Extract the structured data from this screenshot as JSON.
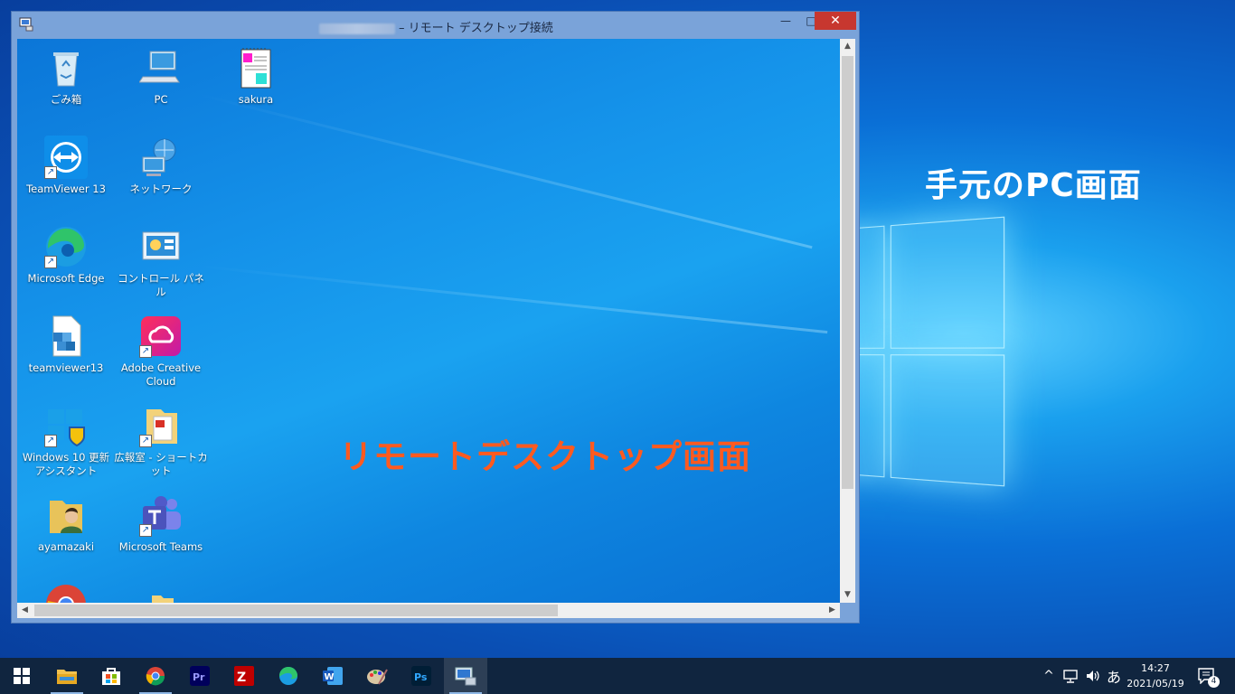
{
  "host": {
    "label": "手元のPC画面",
    "label_color": "#ffffff"
  },
  "rdp_window": {
    "title": "– リモート デスクトップ接続",
    "buttons": {
      "minimize": "—",
      "maximize": "□",
      "close": "✕"
    }
  },
  "remote_desktop": {
    "overlay_label": "リモートデスクトップ画面",
    "overlay_color": "#ff5a1f",
    "icons": [
      {
        "label": "ごみ箱",
        "icon": "recycle-bin-icon"
      },
      {
        "label": "PC",
        "icon": "pc-icon"
      },
      {
        "label": "sakura",
        "icon": "notepad-icon"
      },
      {
        "label": "TeamViewer 13",
        "icon": "teamviewer-icon"
      },
      {
        "label": "ネットワーク",
        "icon": "network-icon"
      },
      {
        "label": "Microsoft Edge",
        "icon": "edge-icon"
      },
      {
        "label": "コントロール パネル",
        "icon": "control-panel-icon"
      },
      {
        "label": "teamviewer13",
        "icon": "installer-icon"
      },
      {
        "label": "Adobe Creative Cloud",
        "icon": "creative-cloud-icon"
      },
      {
        "label": "Windows 10 更新アシスタント",
        "icon": "windows-update-icon"
      },
      {
        "label": "広報室 - ショートカット",
        "icon": "pdf-folder-icon"
      },
      {
        "label": "ayamazaki",
        "icon": "user-folder-icon"
      },
      {
        "label": "Microsoft Teams",
        "icon": "teams-icon"
      }
    ]
  },
  "taskbar": {
    "items": [
      "start-icon",
      "explorer-icon",
      "store-icon",
      "chrome-icon",
      "premiere-icon",
      "filezilla-icon",
      "edge-icon",
      "word-icon",
      "paint-icon",
      "photoshop-icon",
      "remote-desktop-icon"
    ],
    "tray": {
      "chevron": "^",
      "ime": "あ",
      "notification_count": "4"
    },
    "clock": {
      "time": "14:27",
      "date": "2021/05/19"
    }
  }
}
